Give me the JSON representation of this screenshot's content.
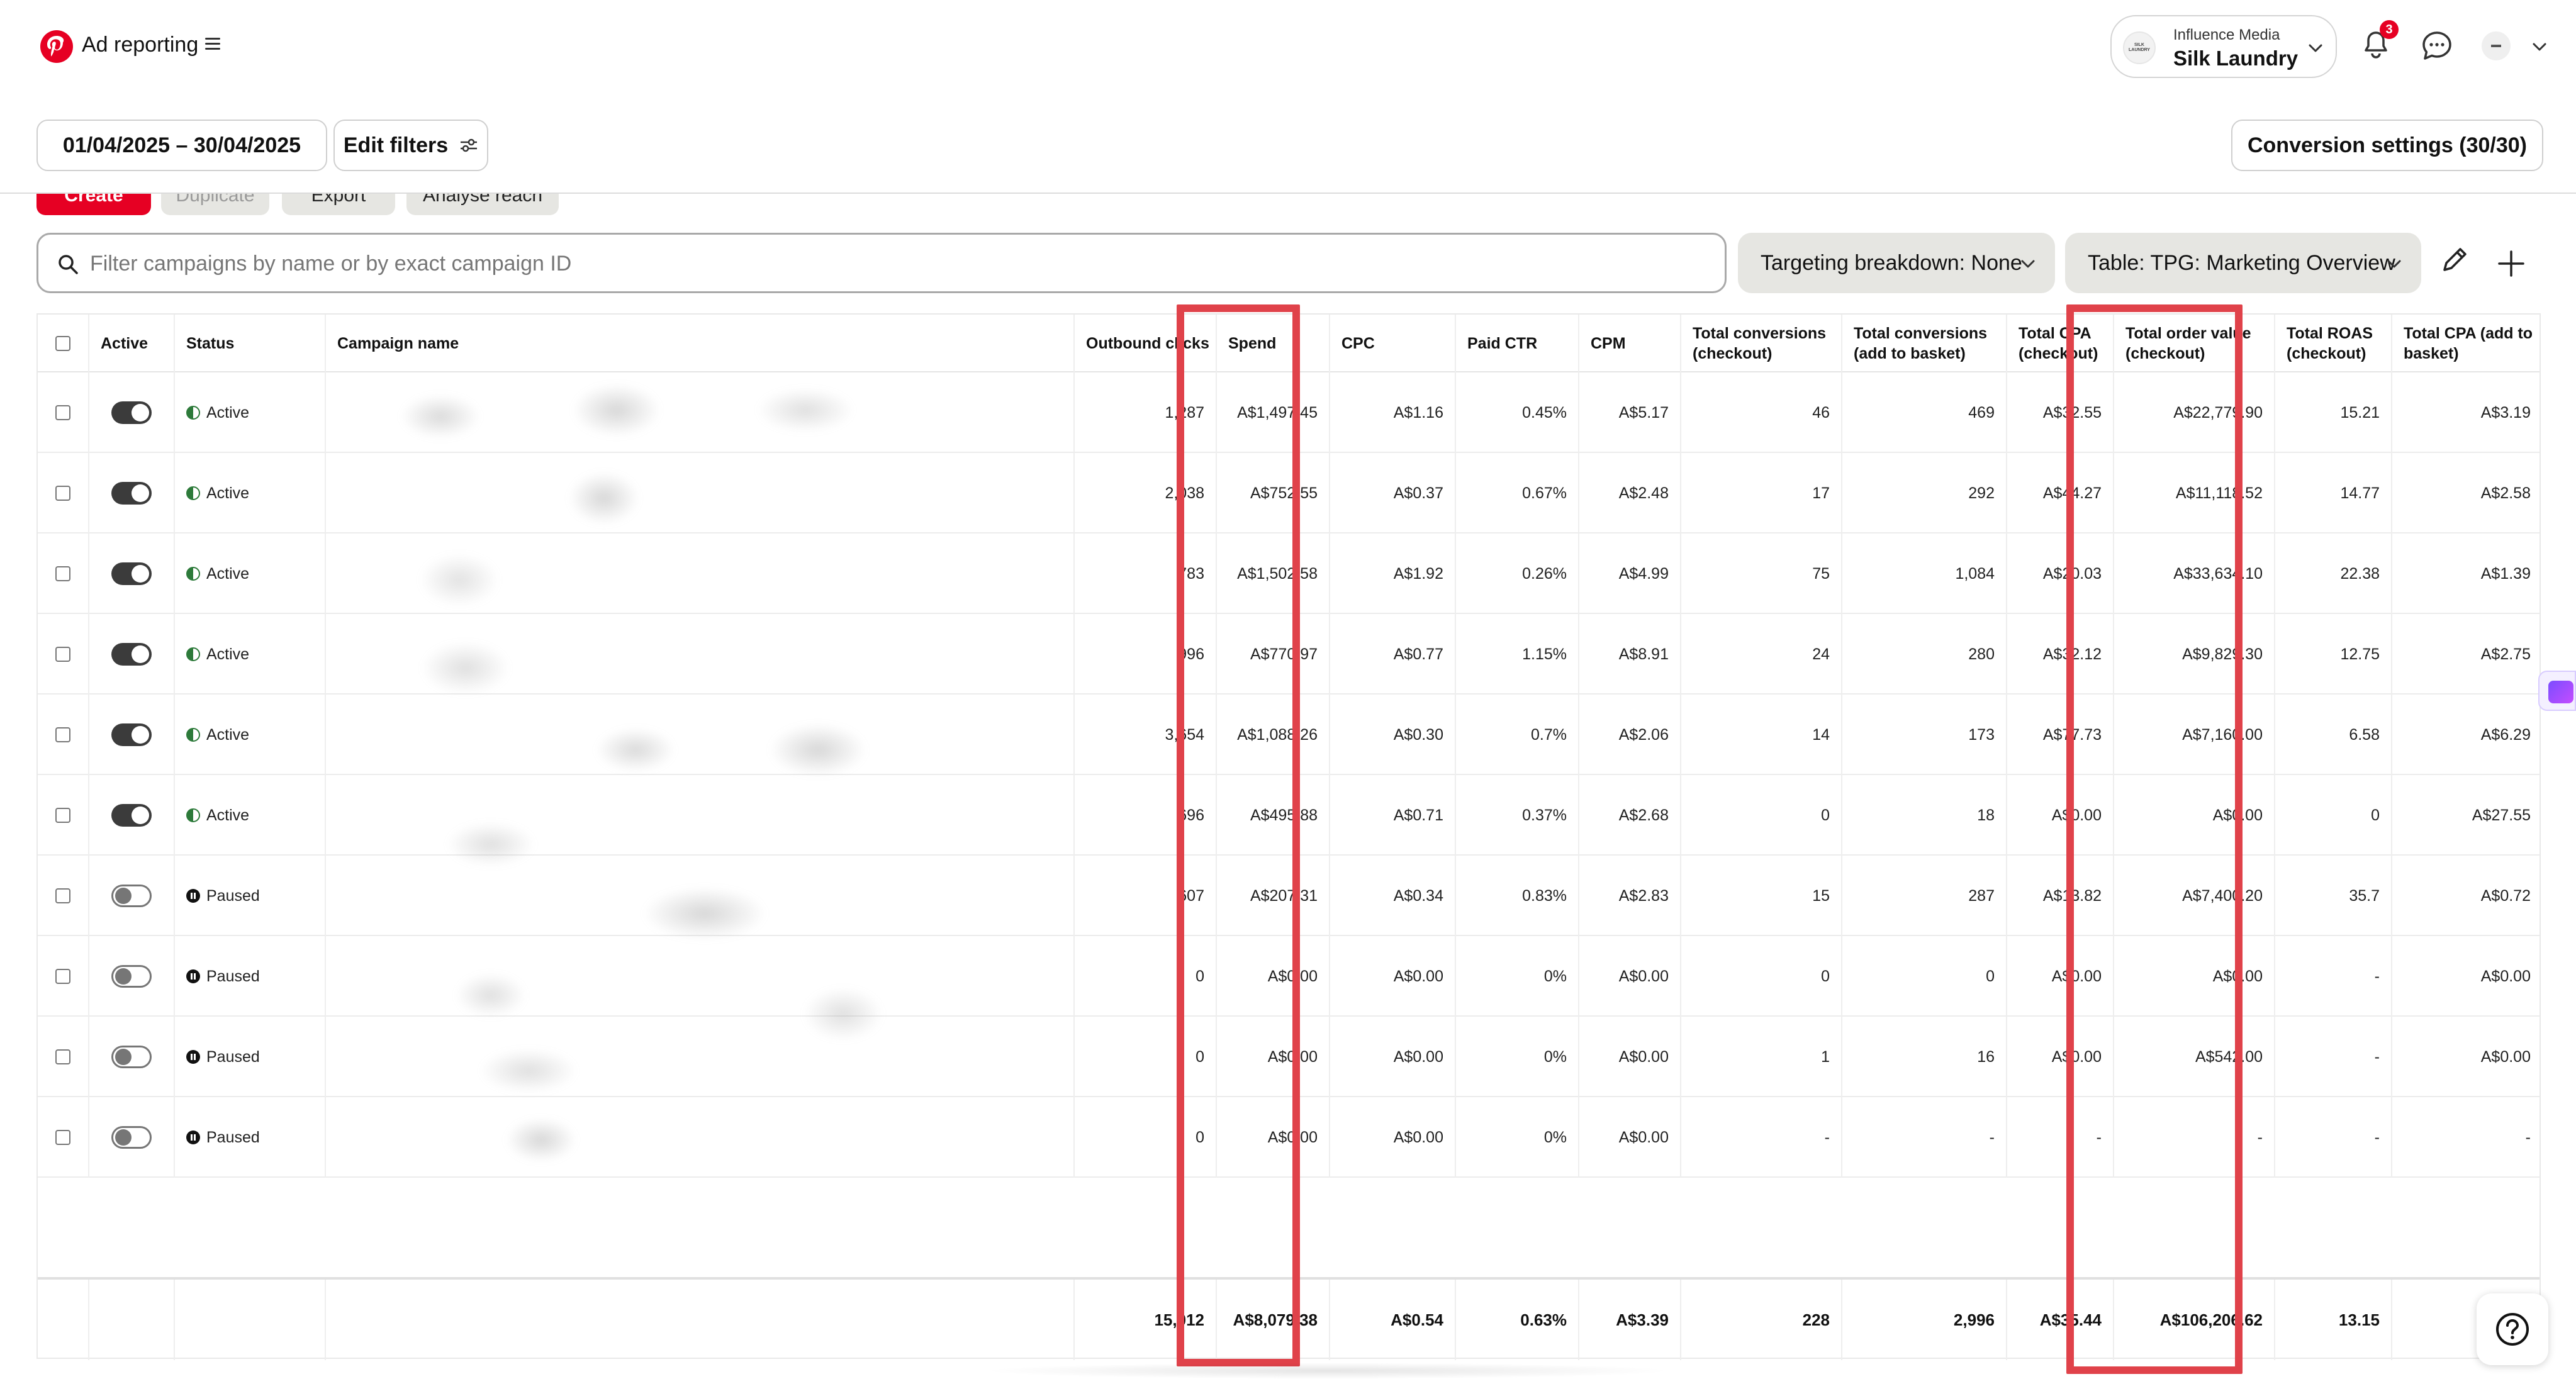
{
  "header": {
    "app_title": "Ad reporting",
    "account": {
      "org": "Influence Media",
      "name": "Silk Laundry",
      "avatar_text": "SILK LAUNDRY"
    },
    "notifications_count": "3",
    "brand_color": "#e60023"
  },
  "filters": {
    "date_range": "01/04/2025 – 30/04/2025",
    "edit_filters": "Edit filters",
    "conversion_settings": "Conversion settings (30/30)"
  },
  "actions": {
    "create": "Create",
    "duplicate": "Duplicate",
    "export": "Export",
    "analyse_reach": "Analyse reach"
  },
  "search": {
    "placeholder": "Filter campaigns by name or by exact campaign ID",
    "value": ""
  },
  "toolbar": {
    "targeting_breakdown": "Targeting breakdown: None",
    "table_select": "Table: TPG: Marketing Overview"
  },
  "table": {
    "columns": [
      "Active",
      "Status",
      "Campaign name",
      "Outbound clicks",
      "Spend",
      "CPC",
      "Paid CTR",
      "CPM",
      "Total conversions (checkout)",
      "Total conversions (add to basket)",
      "Total CPA (checkout)",
      "Total order value (checkout)",
      "Total ROAS (checkout)",
      "Total CPA (add to basket)"
    ],
    "rows": [
      {
        "active": true,
        "status": "Active",
        "campaign": "",
        "clicks": "1,287",
        "spend": "A$1,497.45",
        "cpc": "A$1.16",
        "ctr": "0.45%",
        "cpm": "A$5.17",
        "conv_checkout": "46",
        "conv_basket": "469",
        "cpa_checkout": "A$32.55",
        "order_value": "A$22,779.90",
        "roas": "15.21",
        "cpa_basket": "A$3.19"
      },
      {
        "active": true,
        "status": "Active",
        "campaign": "",
        "clicks": "2,038",
        "spend": "A$752.55",
        "cpc": "A$0.37",
        "ctr": "0.67%",
        "cpm": "A$2.48",
        "conv_checkout": "17",
        "conv_basket": "292",
        "cpa_checkout": "A$44.27",
        "order_value": "A$11,118.52",
        "roas": "14.77",
        "cpa_basket": "A$2.58"
      },
      {
        "active": true,
        "status": "Active",
        "campaign": "",
        "clicks": "783",
        "spend": "A$1,502.58",
        "cpc": "A$1.92",
        "ctr": "0.26%",
        "cpm": "A$4.99",
        "conv_checkout": "75",
        "conv_basket": "1,084",
        "cpa_checkout": "A$20.03",
        "order_value": "A$33,634.10",
        "roas": "22.38",
        "cpa_basket": "A$1.39"
      },
      {
        "active": true,
        "status": "Active",
        "campaign": "",
        "clicks": "996",
        "spend": "A$770.97",
        "cpc": "A$0.77",
        "ctr": "1.15%",
        "cpm": "A$8.91",
        "conv_checkout": "24",
        "conv_basket": "280",
        "cpa_checkout": "A$32.12",
        "order_value": "A$9,829.30",
        "roas": "12.75",
        "cpa_basket": "A$2.75"
      },
      {
        "active": true,
        "status": "Active",
        "campaign": "",
        "clicks": "3,654",
        "spend": "A$1,088.26",
        "cpc": "A$0.30",
        "ctr": "0.7%",
        "cpm": "A$2.06",
        "conv_checkout": "14",
        "conv_basket": "173",
        "cpa_checkout": "A$77.73",
        "order_value": "A$7,160.00",
        "roas": "6.58",
        "cpa_basket": "A$6.29"
      },
      {
        "active": true,
        "status": "Active",
        "campaign": "",
        "clicks": "696",
        "spend": "A$495.88",
        "cpc": "A$0.71",
        "ctr": "0.37%",
        "cpm": "A$2.68",
        "conv_checkout": "0",
        "conv_basket": "18",
        "cpa_checkout": "A$0.00",
        "order_value": "A$0.00",
        "roas": "0",
        "cpa_basket": "A$27.55"
      },
      {
        "active": false,
        "status": "Paused",
        "campaign": "",
        "clicks": "607",
        "spend": "A$207.31",
        "cpc": "A$0.34",
        "ctr": "0.83%",
        "cpm": "A$2.83",
        "conv_checkout": "15",
        "conv_basket": "287",
        "cpa_checkout": "A$13.82",
        "order_value": "A$7,400.20",
        "roas": "35.7",
        "cpa_basket": "A$0.72"
      },
      {
        "active": false,
        "status": "Paused",
        "campaign": "",
        "clicks": "0",
        "spend": "A$0.00",
        "cpc": "A$0.00",
        "ctr": "0%",
        "cpm": "A$0.00",
        "conv_checkout": "0",
        "conv_basket": "0",
        "cpa_checkout": "A$0.00",
        "order_value": "A$0.00",
        "roas": "-",
        "cpa_basket": "A$0.00"
      },
      {
        "active": false,
        "status": "Paused",
        "campaign": "",
        "clicks": "0",
        "spend": "A$0.00",
        "cpc": "A$0.00",
        "ctr": "0%",
        "cpm": "A$0.00",
        "conv_checkout": "1",
        "conv_basket": "16",
        "cpa_checkout": "A$0.00",
        "order_value": "A$542.00",
        "roas": "-",
        "cpa_basket": "A$0.00"
      },
      {
        "active": false,
        "status": "Paused",
        "campaign": "",
        "clicks": "0",
        "spend": "A$0.00",
        "cpc": "A$0.00",
        "ctr": "0%",
        "cpm": "A$0.00",
        "conv_checkout": "-",
        "conv_basket": "-",
        "cpa_checkout": "-",
        "order_value": "-",
        "roas": "-",
        "cpa_basket": "-"
      }
    ],
    "totals": {
      "clicks": "15,012",
      "spend": "A$8,079.38",
      "cpc": "A$0.54",
      "ctr": "0.63%",
      "cpm": "A$3.39",
      "conv_checkout": "228",
      "conv_basket": "2,996",
      "cpa_checkout": "A$35.44",
      "order_value": "A$106,206.62",
      "roas": "13.15"
    },
    "highlight_color": "#e0424a"
  }
}
